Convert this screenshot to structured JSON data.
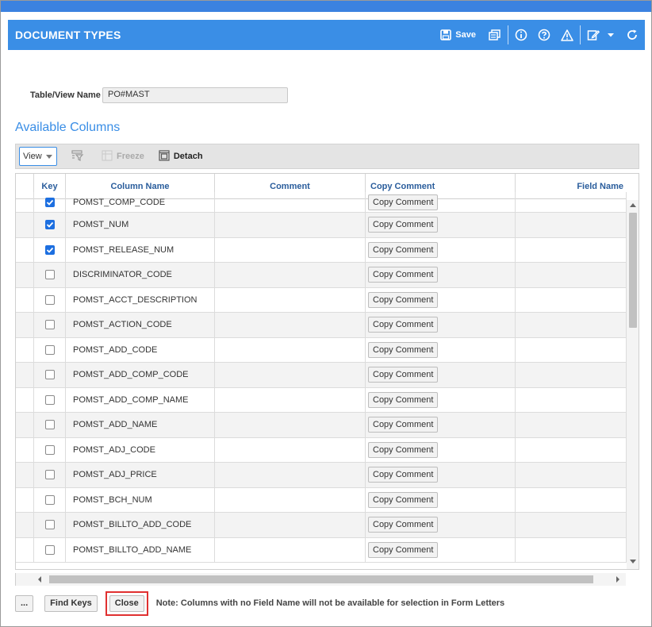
{
  "header": {
    "title": "DOCUMENT TYPES",
    "save_label": "Save",
    "icons": [
      "save-icon",
      "print-icon",
      "info-icon",
      "help-icon",
      "warning-icon",
      "edit-icon",
      "chevron-down-icon",
      "refresh-icon"
    ]
  },
  "form": {
    "table_view_label": "Table/View Name",
    "table_view_value": "PO#MAST"
  },
  "section_title": "Available Columns",
  "grid_toolbar": {
    "view_label": "View",
    "freeze_label": "Freeze",
    "detach_label": "Detach"
  },
  "columns": {
    "key": "Key",
    "column_name": "Column Name",
    "comment": "Comment",
    "copy_comment": "Copy Comment",
    "field_name": "Field Name"
  },
  "copy_button_label": "Copy Comment",
  "rows": [
    {
      "checked": true,
      "name": "POMST_COMP_CODE"
    },
    {
      "checked": true,
      "name": "POMST_NUM"
    },
    {
      "checked": true,
      "name": "POMST_RELEASE_NUM"
    },
    {
      "checked": false,
      "name": "DISCRIMINATOR_CODE"
    },
    {
      "checked": false,
      "name": "POMST_ACCT_DESCRIPTION"
    },
    {
      "checked": false,
      "name": "POMST_ACTION_CODE"
    },
    {
      "checked": false,
      "name": "POMST_ADD_CODE"
    },
    {
      "checked": false,
      "name": "POMST_ADD_COMP_CODE"
    },
    {
      "checked": false,
      "name": "POMST_ADD_COMP_NAME"
    },
    {
      "checked": false,
      "name": "POMST_ADD_NAME"
    },
    {
      "checked": false,
      "name": "POMST_ADJ_CODE"
    },
    {
      "checked": false,
      "name": "POMST_ADJ_PRICE"
    },
    {
      "checked": false,
      "name": "POMST_BCH_NUM"
    },
    {
      "checked": false,
      "name": "POMST_BILLTO_ADD_CODE"
    },
    {
      "checked": false,
      "name": "POMST_BILLTO_ADD_NAME"
    }
  ],
  "footer": {
    "more_label": "...",
    "find_keys_label": "Find Keys",
    "close_label": "Close",
    "note": "Note: Columns with no Field Name will not be available for selection in Form Letters"
  },
  "colors": {
    "header_bg": "#3a8ee6",
    "accent": "#1d6fe0",
    "highlight": "#e03030"
  }
}
